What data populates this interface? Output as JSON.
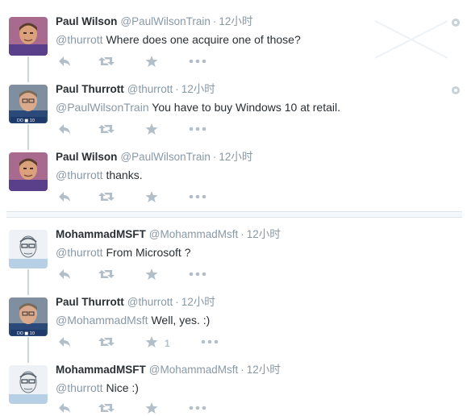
{
  "colors": {
    "name": "#292f33",
    "secondary": "#8899a6",
    "action": "#b3bfc8",
    "thread_line": "#ccd6dd"
  },
  "tweets": [
    {
      "fullname": "Paul Wilson",
      "username": "@PaulWilsonTrain",
      "dot": "·",
      "time": "12小时",
      "mention": "@thurrott",
      "body": " Where does one acquire one of those?",
      "avatar": "paul-wilson-avatar",
      "favorite_count": ""
    },
    {
      "fullname": "Paul Thurrott",
      "username": "@thurrott",
      "dot": "·",
      "time": "12小时",
      "mention": "@PaulWilsonTrain",
      "body": " You have to buy Windows 10 at retail.",
      "avatar": "paul-thurrott-avatar",
      "favorite_count": ""
    },
    {
      "fullname": "Paul Wilson",
      "username": "@PaulWilsonTrain",
      "dot": "·",
      "time": "12小时",
      "mention": "@thurrott",
      "body": " thanks.",
      "avatar": "paul-wilson-avatar",
      "favorite_count": ""
    },
    {
      "fullname": "MohammadMSFT",
      "username": "@MohammadMsft",
      "dot": "·",
      "time": "12小时",
      "mention": "@thurrott",
      "body": " From Microsoft ?",
      "avatar": "mohammad-avatar",
      "favorite_count": ""
    },
    {
      "fullname": "Paul Thurrott",
      "username": "@thurrott",
      "dot": "·",
      "time": "12小时",
      "mention": "@MohammadMsft",
      "body": " Well, yes. :)",
      "avatar": "paul-thurrott-avatar",
      "favorite_count": "1"
    },
    {
      "fullname": "MohammadMSFT",
      "username": "@MohammadMsft",
      "dot": "·",
      "time": "12小时",
      "mention": "@thurrott",
      "body": " Nice :)",
      "avatar": "mohammad-avatar",
      "favorite_count": ""
    }
  ],
  "icons": {
    "reply": "reply-icon",
    "retweet": "retweet-icon",
    "favorite": "star-icon",
    "more": "more-icon",
    "settings": "gear-icon"
  }
}
